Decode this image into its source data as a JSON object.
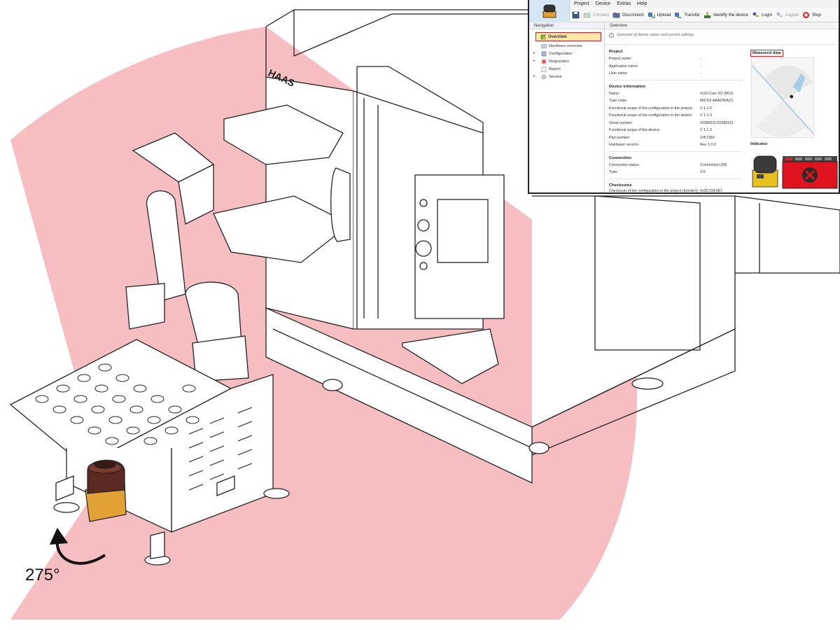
{
  "illustration": {
    "rotation_label": "275°",
    "machine_brand": "HAAS",
    "colors": {
      "protective_field": "#f6b3b7",
      "sensor_body": "#e3a034",
      "sensor_top": "#5a2a22"
    }
  },
  "app": {
    "menu": [
      "Project",
      "Device",
      "Extras",
      "Help"
    ],
    "toolbar": [
      {
        "icon": "save-icon",
        "label": "",
        "enabled": true
      },
      {
        "icon": "connect-icon",
        "label": "Connect",
        "enabled": false
      },
      {
        "icon": "disconnect-icon",
        "label": "Disconnect",
        "enabled": true
      },
      {
        "icon": "upload-icon",
        "label": "Upload",
        "enabled": true
      },
      {
        "icon": "transfer-icon",
        "label": "Transfer",
        "enabled": true
      },
      {
        "icon": "identify-icon",
        "label": "Identify the device",
        "enabled": true
      },
      {
        "icon": "login-icon",
        "label": "Login",
        "enabled": true
      },
      {
        "icon": "logout-icon",
        "label": "Logout",
        "enabled": false
      },
      {
        "icon": "stop-icon",
        "label": "Stop",
        "enabled": true
      }
    ],
    "navigation": {
      "title": "Navigation",
      "items": [
        {
          "label": "Overview",
          "selected": true,
          "expandable": false,
          "icon": "overview-icon"
        },
        {
          "label": "Hardware overview",
          "selected": false,
          "expandable": false,
          "icon": "hardware-icon"
        },
        {
          "label": "Configuration",
          "selected": false,
          "expandable": true,
          "icon": "configuration-icon"
        },
        {
          "label": "Diagnostics",
          "selected": false,
          "expandable": true,
          "icon": "diagnostics-icon"
        },
        {
          "label": "Report",
          "selected": false,
          "expandable": false,
          "icon": "report-icon"
        },
        {
          "label": "Service",
          "selected": false,
          "expandable": true,
          "icon": "service-icon"
        }
      ]
    },
    "overview": {
      "title": "Overview",
      "subtitle": "Overview of device status and current settings",
      "project": {
        "title": "Project",
        "rows": [
          {
            "label": "Project name:",
            "value": "-"
          },
          {
            "label": "Application name:",
            "value": "-"
          },
          {
            "label": "User name",
            "value": "-"
          }
        ]
      },
      "device": {
        "title": "Device information",
        "rows": [
          {
            "label": "Name:",
            "value": "mS3 Core I/O (M12)"
          },
          {
            "label": "Type code:",
            "value": "MICS3-AAAZ40AZ1"
          },
          {
            "label": "Functional scope of the configuration in the project:",
            "value": "V 1.1.0"
          },
          {
            "label": "Functional scope of the configuration in the device:",
            "value": "V 1.1.0"
          },
          {
            "label": "Serial number:",
            "value": "20380911/20380911"
          },
          {
            "label": "Functional scope of the device:",
            "value": "V 1.1.0"
          },
          {
            "label": "Part number:",
            "value": "1067360"
          },
          {
            "label": "Hardware version:",
            "value": "Rev 1.0.0"
          }
        ]
      },
      "connection": {
        "title": "Connection",
        "rows": [
          {
            "label": "Connection status:",
            "value": "Connected USB"
          },
          {
            "label": "Type:",
            "value": "3-6"
          }
        ]
      },
      "checksums": {
        "title": "Checksums",
        "rows": [
          {
            "label": "Checksum of the configuration in the project (function)",
            "value": "0x3C7DE0B7"
          }
        ]
      },
      "measured_data_title": "Measured data",
      "indicator_title": "Indicator"
    },
    "colors": {
      "accent_red": "#d0202a",
      "selection_fill": "#fbe6a8",
      "header_blue": "#d7e6f4"
    }
  }
}
